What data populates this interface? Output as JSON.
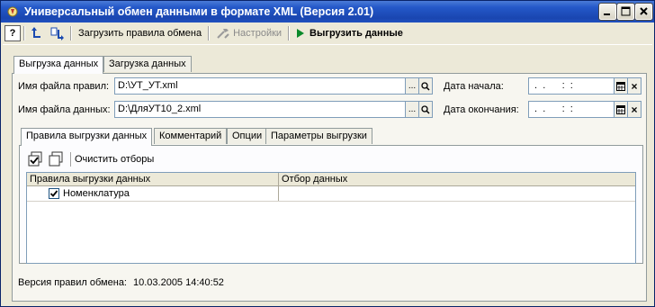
{
  "window": {
    "title": "Универсальный обмен данными в формате XML (Версия 2.01)"
  },
  "toolbar": {
    "help_label": "?",
    "load_rules_label": "Загрузить правила обмена",
    "settings_label": "Настройки",
    "export_label": "Выгрузить данные"
  },
  "main_tabs": [
    {
      "label": "Выгрузка данных",
      "active": true
    },
    {
      "label": "Загрузка данных",
      "active": false
    }
  ],
  "form": {
    "rules_file_label": "Имя файла правил:",
    "rules_file_value": "D:\\УТ_УТ.xml",
    "data_file_label": "Имя файла данных:",
    "data_file_value": "D:\\ДляУТ10_2.xml",
    "start_date_label": "Дата начала:",
    "start_date_value": " .  .      :  :",
    "end_date_label": "Дата окончания:",
    "end_date_value": " .  .      :  :",
    "browse_label": "...",
    "clear_label": "×"
  },
  "inner_tabs": [
    {
      "label": "Правила выгрузки данных",
      "active": true
    },
    {
      "label": "Комментарий",
      "active": false
    },
    {
      "label": "Опции",
      "active": false
    },
    {
      "label": "Параметры выгрузки",
      "active": false
    }
  ],
  "grid_toolbar": {
    "clear_filters_label": "Очистить отборы"
  },
  "grid": {
    "columns": [
      "Правила выгрузки данных",
      "Отбор данных"
    ],
    "rows": [
      {
        "checked": true,
        "name": "Номенклатура",
        "filter": ""
      }
    ]
  },
  "footer": {
    "version_label": "Версия правил обмена:",
    "version_value": "10.03.2005 14:40:52"
  }
}
